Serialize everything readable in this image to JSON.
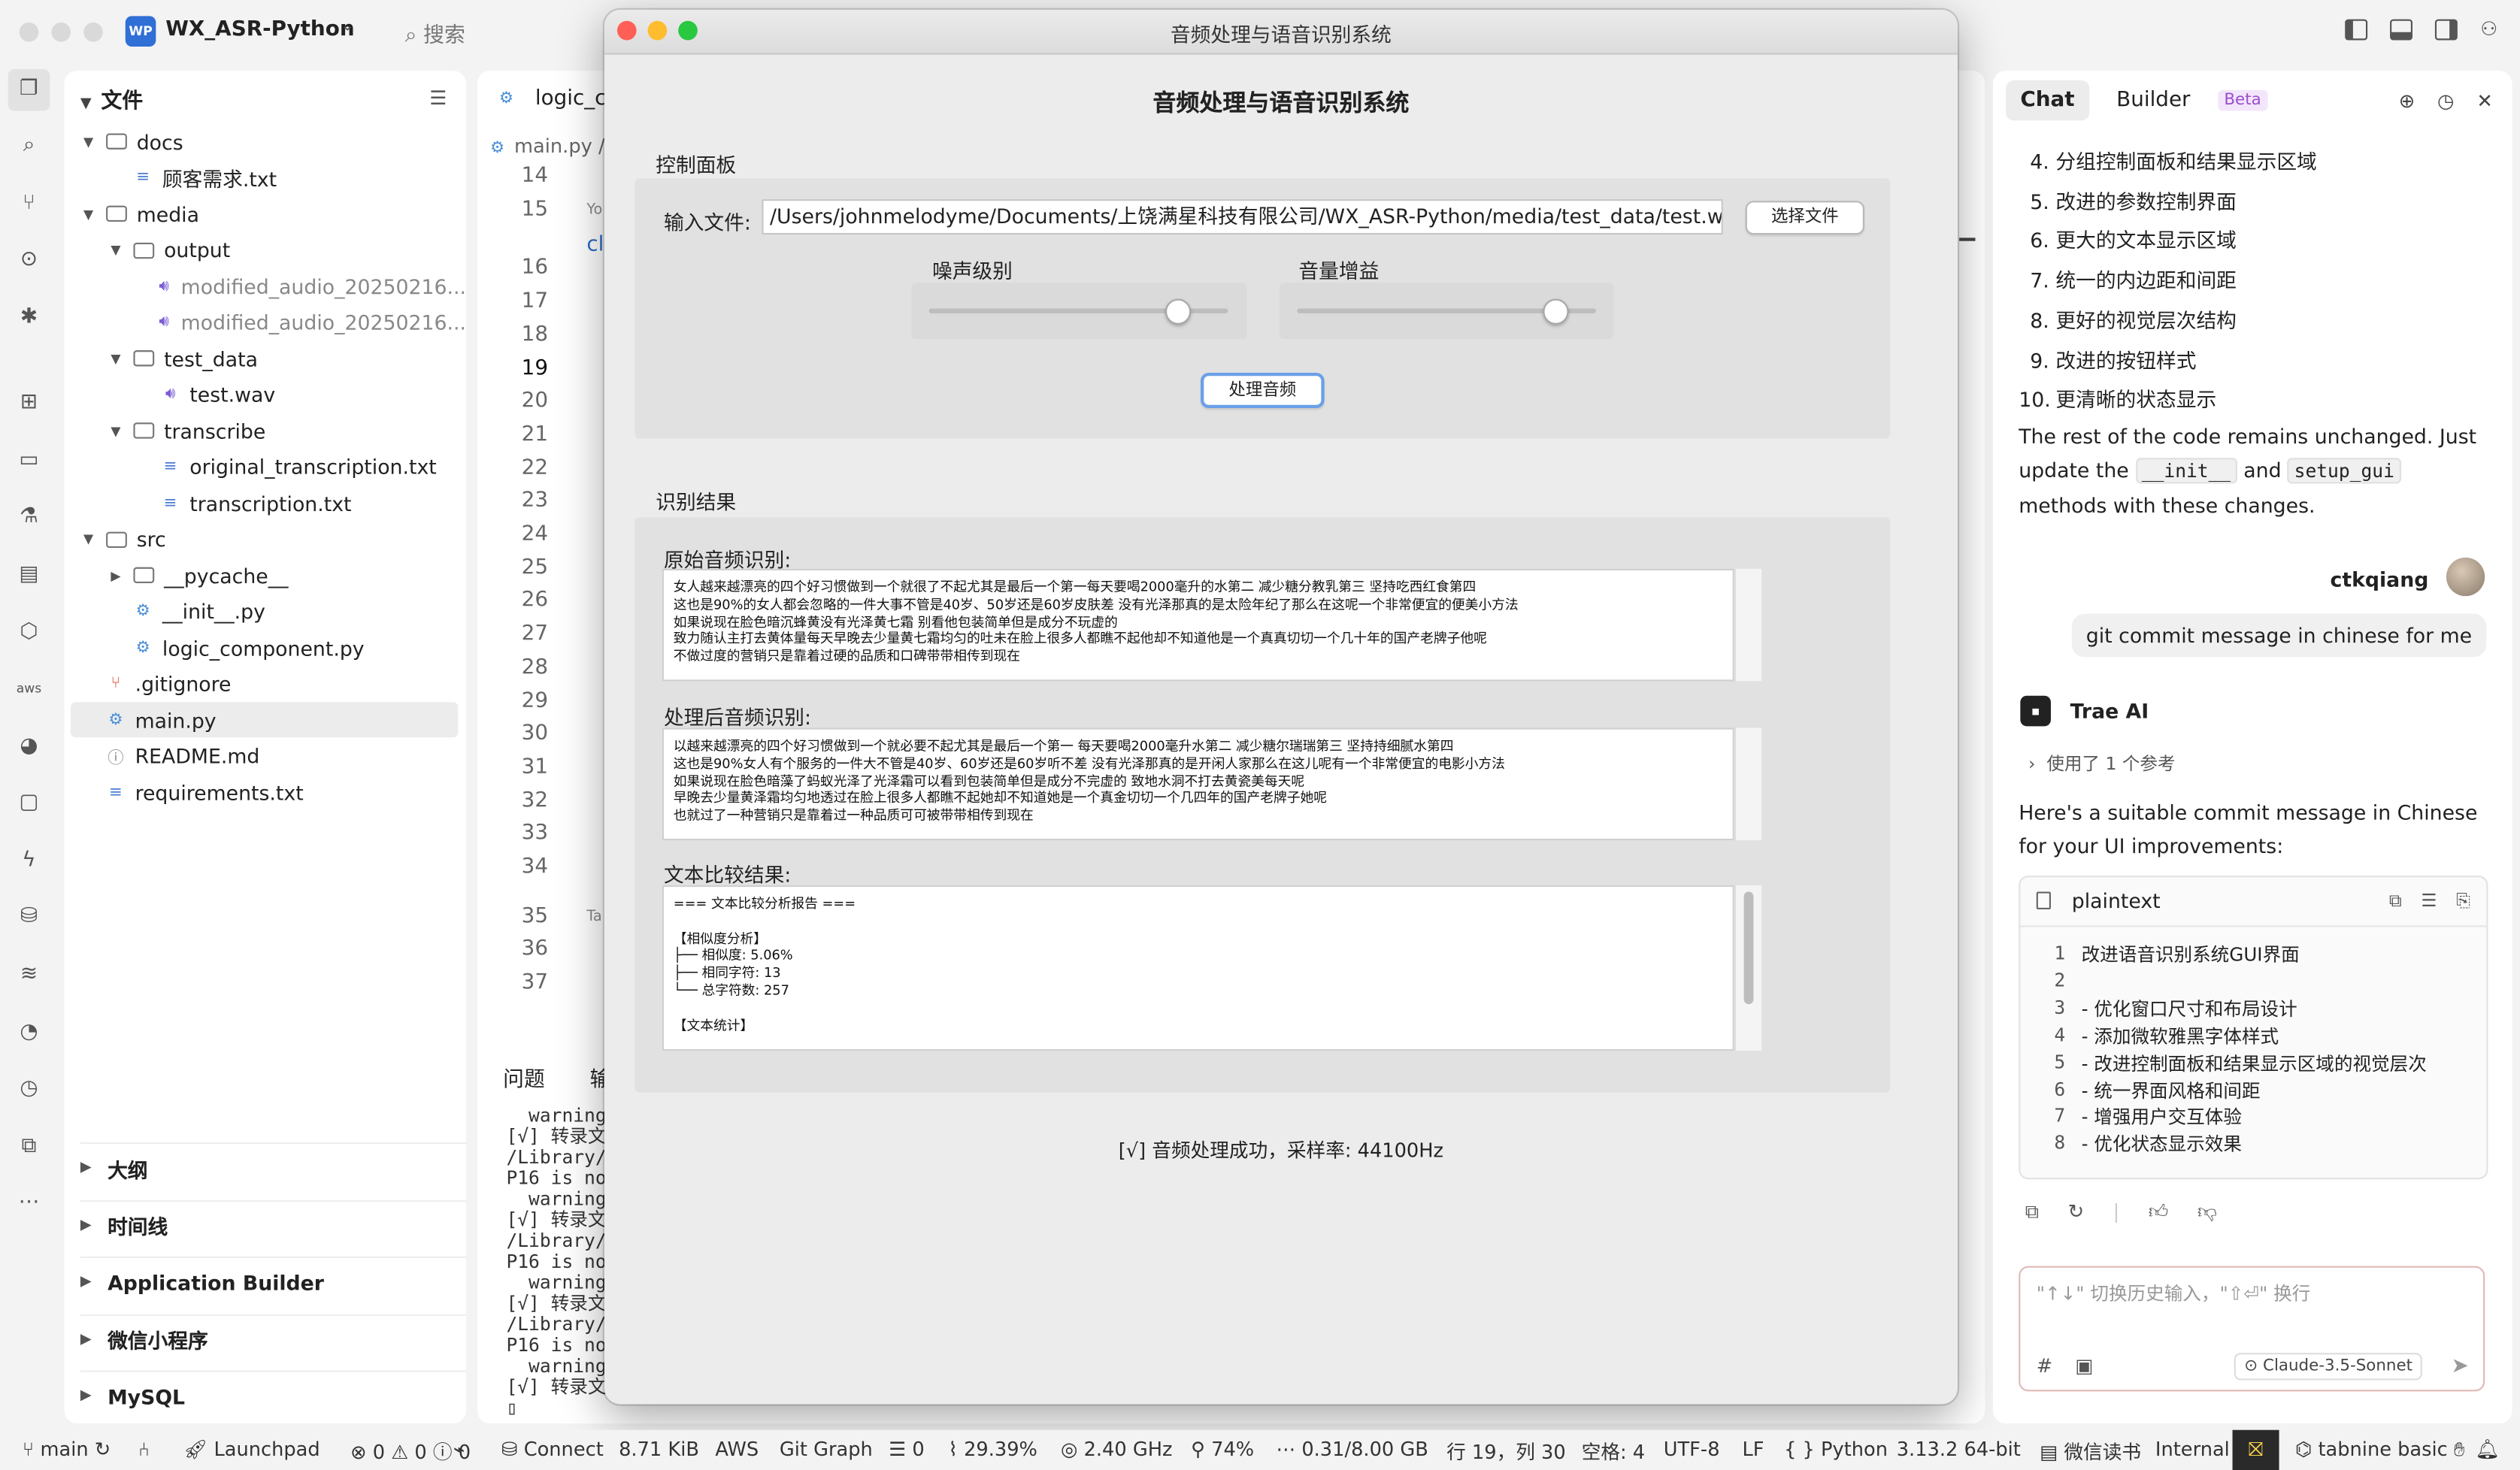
{
  "topbar": {
    "project_badge": "WP",
    "project_name": "WX_ASR-Python",
    "search_placeholder": "搜索"
  },
  "explorer": {
    "title": "文件",
    "tree": [
      {
        "label": "docs",
        "kind": "folder",
        "depth": 0,
        "open": true
      },
      {
        "label": "顾客需求.txt",
        "kind": "txt",
        "depth": 1
      },
      {
        "label": "media",
        "kind": "folder",
        "depth": 0,
        "open": true
      },
      {
        "label": "output",
        "kind": "folder",
        "depth": 1,
        "open": true
      },
      {
        "label": "modified_audio_20250216...",
        "kind": "wav",
        "depth": 2,
        "dim": true
      },
      {
        "label": "modified_audio_20250216...",
        "kind": "wav",
        "depth": 2,
        "dim": true
      },
      {
        "label": "test_data",
        "kind": "folder",
        "depth": 1,
        "open": true
      },
      {
        "label": "test.wav",
        "kind": "wav",
        "depth": 2
      },
      {
        "label": "transcribe",
        "kind": "folder",
        "depth": 1,
        "open": true
      },
      {
        "label": "original_transcription.txt",
        "kind": "txt",
        "depth": 2
      },
      {
        "label": "transcription.txt",
        "kind": "txt",
        "depth": 2
      },
      {
        "label": "src",
        "kind": "folder",
        "depth": 0,
        "open": true
      },
      {
        "label": "__pycache__",
        "kind": "folder",
        "depth": 1,
        "open": false
      },
      {
        "label": "__init__.py",
        "kind": "py",
        "depth": 1
      },
      {
        "label": "logic_component.py",
        "kind": "py",
        "depth": 1
      },
      {
        "label": ".gitignore",
        "kind": "git",
        "depth": 0
      },
      {
        "label": "main.py",
        "kind": "py",
        "depth": 0,
        "selected": true
      },
      {
        "label": "README.md",
        "kind": "md",
        "depth": 0
      },
      {
        "label": "requirements.txt",
        "kind": "txt",
        "depth": 0
      }
    ],
    "sections": [
      "大纲",
      "时间线",
      "Application Builder",
      "微信小程序",
      "MySQL"
    ]
  },
  "editor": {
    "tab_label": "logic_co",
    "breadcrumb": "main.py  /",
    "line_numbers": [
      "14",
      "15",
      "16",
      "17",
      "18",
      "19",
      "20",
      "21",
      "22",
      "23",
      "24",
      "25",
      "26",
      "27",
      "28",
      "29",
      "30",
      "31",
      "32",
      "33",
      "34",
      "35",
      "36",
      "37"
    ],
    "current_line": "19",
    "code_fragment": "cl",
    "hint_text": "Yo",
    "hint_text2": "Ta",
    "panel_tabs": [
      "问题",
      "输"
    ],
    "terminal_lines": [
      "  warnings",
      "[√] 转录文",
      "/Library/",
      "P16 is not",
      "  warnings",
      "[√] 转录文",
      "/Library/",
      "P16 is not",
      "  warnings",
      "[√] 转录文",
      "/Library/",
      "P16 is not",
      "  warnings",
      "[√] 转录文",
      "▯"
    ]
  },
  "app": {
    "window_title": "音频处理与语音识别系统",
    "heading": "音频处理与语音识别系统",
    "control_panel_label": "控制面板",
    "input_file_label": "输入文件:",
    "input_file_value": "/Users/johnmelodyme/Documents/上饶满星科技有限公司/WX_ASR-Python/media/test_data/test.wav",
    "choose_file_button": "选择文件",
    "noise_label": "噪声级别",
    "noise_level": 0.83,
    "gain_label": "音量增益",
    "gain_level": 0.86,
    "process_button": "处理音频",
    "results_label": "识别结果",
    "original_label": "原始音频识别:",
    "original_text": "女人越来越漂亮的四个好习惯做到一个就很了不起尤其是最后一个第一每天要喝2000毫升的水第二 减少糖分教乳第三 坚持吃西红食第四\n这也是90%的女人都会忽略的一件大事不管是40岁、50岁还是60岁皮肤差 没有光泽那真的是太险年纪了那么在这呢一个非常便宜的便美小方法\n如果说现在脸色暗沉蜂黄没有光泽黄七霜 别看他包装简单但是成分不玩虚的\n致力随认主打去黄体量每天早晚去少量黄七霜均匀的吐未在脸上很多人都瞧不起他却不知道他是一个真真切切一个几十年的国产老牌子他呢\n不做过度的营销只是靠着过硬的品质和口碑带带相传到现在",
    "processed_label": "处理后音频识别:",
    "processed_text": "以越来越漂亮的四个好习惯做到一个就必要不起尤其是最后一个第一 每天要喝2000毫升水第二 减少糖尔瑞瑞第三 坚持持细腻水第四\n这也是90%女人有个服务的一件大不管是40岁、60岁还是60岁听不差 没有光泽那真的是开闲人家那么在这儿呢有一个非常便宜的电影小方法\n如果说现在脸色暗藻了蚂蚁光泽了光泽霜可以看到包装简单但是成分不完虚的 致地水洞不打去黄瓷美每天呢\n早晚去少量黄泽霜均匀地透过在脸上很多人都瞧不起她却不知道她是一个真金切切一个几四年的国产老牌子她呢\n也就过了一种营销只是靠着过一种品质可可被带带相传到现在",
    "compare_label": "文本比较结果:",
    "compare_text": "=== 文本比较分析报告 ===\n\n【相似度分析】\n├── 相似度: 5.06%\n├── 相同字符: 13\n└── 总字符数: 257\n\n【文本统计】",
    "status_message": "[√] 音频处理成功，采样率: 44100Hz"
  },
  "chat": {
    "tabs": [
      "Chat",
      "Builder"
    ],
    "beta_badge": "Beta",
    "list_items": [
      {
        "num": "4.",
        "text": "分组控制面板和结果显示区域"
      },
      {
        "num": "5.",
        "text": "改进的参数控制界面"
      },
      {
        "num": "6.",
        "text": "更大的文本显示区域"
      },
      {
        "num": "7.",
        "text": "统一的内边距和间距"
      },
      {
        "num": "8.",
        "text": "更好的视觉层次结构"
      },
      {
        "num": "9.",
        "text": "改进的按钮样式"
      },
      {
        "num": "10.",
        "text": "更清晰的状态显示"
      }
    ],
    "rest_text_1": "The rest of the code remains unchanged. Just update the",
    "code_init": "__init__",
    "rest_and": "and",
    "code_setup": "setup_gui",
    "rest_text_2": "methods with these changes.",
    "user_name": "ctkqiang",
    "user_message": "git commit message in chinese for me",
    "ai_name": "Trae AI",
    "reference_text": "使用了 1 个参考",
    "ai_intro": "Here's a suitable commit message in Chinese for your UI improvements:",
    "code_lang": "plaintext",
    "code_lines": [
      {
        "n": "1",
        "text": "改进语音识别系统GUI界面"
      },
      {
        "n": "2",
        "text": ""
      },
      {
        "n": "3",
        "text": "- 优化窗口尺寸和布局设计"
      },
      {
        "n": "4",
        "text": "- 添加微软雅黑字体样式"
      },
      {
        "n": "5",
        "text": "- 改进控制面板和结果显示区域的视觉层次"
      },
      {
        "n": "6",
        "text": "- 统一界面风格和间距"
      },
      {
        "n": "7",
        "text": "- 增强用户交互体验"
      },
      {
        "n": "8",
        "text": "- 优化状态显示效果"
      }
    ],
    "input_placeholder": "\"↑↓\" 切换历史输入，\"⇧⏎\" 换行",
    "model": "Claude-3.5-Sonnet"
  },
  "statusbar": {
    "branch": "main",
    "launchpad": "Launchpad",
    "errors": "0",
    "warnings": "0",
    "infos": "0",
    "connect": "Connect",
    "filesize": "8.71 KiB",
    "aws": "AWS",
    "git_graph": "Git Graph",
    "list_count": "0",
    "cpu": "29.39%",
    "freq": "2.40 GHz",
    "battery": "74%",
    "memory": "0.31/8.00 GB",
    "cursor": "行 19，列 30",
    "spaces": "空格: 4",
    "encoding": "UTF-8",
    "eol": "LF",
    "language": "Python",
    "python_version": "3.13.2 64-bit",
    "wechat_read": "微信读书",
    "internal": "Internal",
    "tabnine": "tabnine basic"
  },
  "colors": {
    "close": "#ff5f57",
    "minimize": "#febc2e",
    "zoom": "#28c840",
    "accent": "#2f6fd6"
  }
}
